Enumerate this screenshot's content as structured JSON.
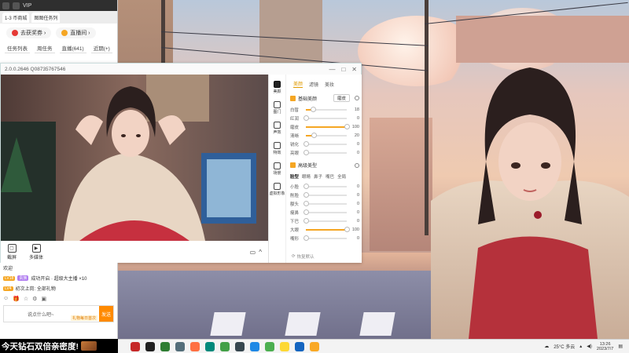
{
  "browser": {
    "title": "VIP",
    "tabs": [
      "1-3 币商城",
      "图图任务列"
    ],
    "pills": [
      {
        "label": "去获奖券 ›",
        "color": "#e53935"
      },
      {
        "label": "直播间 ›",
        "color": "#f5a623"
      }
    ],
    "links": [
      "任务列表",
      "周任务",
      "直播(641)",
      "近期(+)"
    ]
  },
  "stream_app": {
    "title": "2.0.0.2646 Q08735767546",
    "window_buttons": [
      "—",
      "□",
      "✕"
    ],
    "tools": [
      {
        "icon": "screenshot-icon",
        "label": "截屏"
      },
      {
        "icon": "record-icon",
        "label": "多媒体"
      }
    ],
    "right_tools": [
      "▭",
      "^"
    ]
  },
  "beauty": {
    "nav": [
      {
        "icon": "beauty-icon",
        "label": "美颜"
      },
      {
        "icon": "layers-icon",
        "label": "图门"
      },
      {
        "icon": "timer-icon",
        "label": "声效"
      },
      {
        "icon": "tools-icon",
        "label": "特效"
      },
      {
        "icon": "scene-icon",
        "label": "场景"
      },
      {
        "icon": "camera-icon",
        "label": "虚拟形象"
      }
    ],
    "tabs": [
      "美颜",
      "滤镜",
      "美妆"
    ],
    "section1": {
      "label": "基础美颜",
      "mode": "磨皮"
    },
    "section1_sliders": [
      {
        "label": "白皙",
        "value": 18
      },
      {
        "label": "红润",
        "value": 0
      },
      {
        "label": "磨皮",
        "value": 100
      },
      {
        "label": "清晰",
        "value": 20
      },
      {
        "label": "锐化",
        "value": 0
      },
      {
        "label": "亮眼",
        "value": 0
      }
    ],
    "section2": {
      "label": "高级美型"
    },
    "subtabs": [
      "脸型",
      "眼睛",
      "鼻子",
      "嘴巴",
      "全局"
    ],
    "section2_sliders": [
      {
        "label": "小脸",
        "value": 0
      },
      {
        "label": "削脸",
        "value": 0
      },
      {
        "label": "额头",
        "value": 0
      },
      {
        "label": "瘦鼻",
        "value": 0
      },
      {
        "label": "下巴",
        "value": 0
      },
      {
        "label": "大眼",
        "value": 100
      },
      {
        "label": "嘴形",
        "value": 0
      }
    ],
    "restore_label": "恢复默认"
  },
  "chat": {
    "lines": [
      {
        "badges": [],
        "text": "欢迎"
      },
      {
        "badges": [
          {
            "t": "LV18",
            "c": "#f5a623"
          },
          {
            "t": "贵族",
            "c": "#b07cf0"
          }
        ],
        "text": "成功开启 · 超级大主播 ×10"
      },
      {
        "badges": [
          {
            "t": "LV4",
            "c": "#f5a623"
          }
        ],
        "text": "初次上岗: 全部礼物"
      }
    ],
    "input_placeholder": "说点什么吧~",
    "send_label": "发送",
    "hint": "礼物每日首次"
  },
  "banner": {
    "text": "今天钻石双倍亲密度!"
  },
  "taskbar": {
    "apps": [
      "#c62828",
      "#202020",
      "#2e7d32",
      "#546e7a",
      "#ff7043",
      "#00897b",
      "#43a047",
      "#37474f",
      "#1e88e5",
      "#4caf50",
      "#fdd835",
      "#1565c0",
      "#f9a825"
    ],
    "weather": "25°C 多云",
    "time": "13:26",
    "date": "2023/7/7"
  }
}
